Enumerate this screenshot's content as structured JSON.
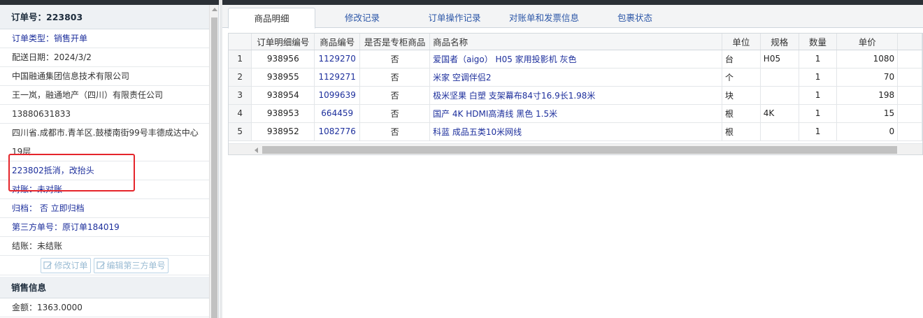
{
  "order": {
    "header": "订单号：223803",
    "fields": [
      {
        "text": "订单类型：销售开单",
        "style": "blue"
      },
      {
        "text": "配送日期：2024/3/2",
        "style": "normal"
      },
      {
        "text": "中国融通集团信息技术有限公司",
        "style": "normal"
      },
      {
        "text": "王一岚，融通地产（四川）有限责任公司",
        "style": "normal"
      },
      {
        "text": "13880631833",
        "style": "normal"
      },
      {
        "text": "四川省.成都市.青羊区.鼓楼南街99号丰德成达中心19层",
        "style": "multi"
      },
      {
        "text": "223802抵消，改抬头",
        "style": "blue"
      },
      {
        "text": "对账：未对账",
        "style": "blue"
      },
      {
        "text": "归档： 否 立即归档",
        "style": "blue"
      },
      {
        "text": "第三方单号：原订单184019",
        "style": "blue"
      },
      {
        "text": "结账：未结账",
        "style": "normal"
      }
    ],
    "buttons": {
      "edit_order": "修改订单",
      "edit_third_party": "编辑第三方单号"
    }
  },
  "sales": {
    "header": "销售信息",
    "amount": "金额：1363.0000"
  },
  "tabs": [
    {
      "label": "商品明细",
      "active": true
    },
    {
      "label": "修改记录",
      "active": false
    },
    {
      "label": "订单操作记录",
      "active": false
    },
    {
      "label": "对账单和发票信息",
      "active": false
    },
    {
      "label": "包裹状态",
      "active": false
    }
  ],
  "table": {
    "columns": [
      "",
      "订单明细编号",
      "商品编号",
      "是否是专柜商品",
      "商品名称",
      "单位",
      "规格",
      "数量",
      "单价"
    ],
    "rows": [
      [
        "1",
        "938956",
        "1129270",
        "否",
        "爱国者（aigo） H05 家用投影机 灰色",
        "台",
        "H05",
        "1",
        "1080"
      ],
      [
        "2",
        "938955",
        "1129271",
        "否",
        "米家 空调伴侣2",
        "个",
        "",
        "1",
        "70"
      ],
      [
        "3",
        "938954",
        "1099639",
        "否",
        "极米坚果 白塑 支架幕布84寸16.9长1.98米",
        "块",
        "",
        "1",
        "198"
      ],
      [
        "4",
        "938953",
        "664459",
        "否",
        "国产 4K HDMI高清线 黑色 1.5米",
        "根",
        "4K",
        "1",
        "15"
      ],
      [
        "5",
        "938952",
        "1082776",
        "否",
        "科蓝 成品五类10米网线",
        "根",
        "",
        "1",
        "0"
      ]
    ]
  },
  "colors": {
    "accent_blue": "#1d2f9c",
    "highlight_red": "#e5252b",
    "tab_link": "#2d57a8"
  }
}
